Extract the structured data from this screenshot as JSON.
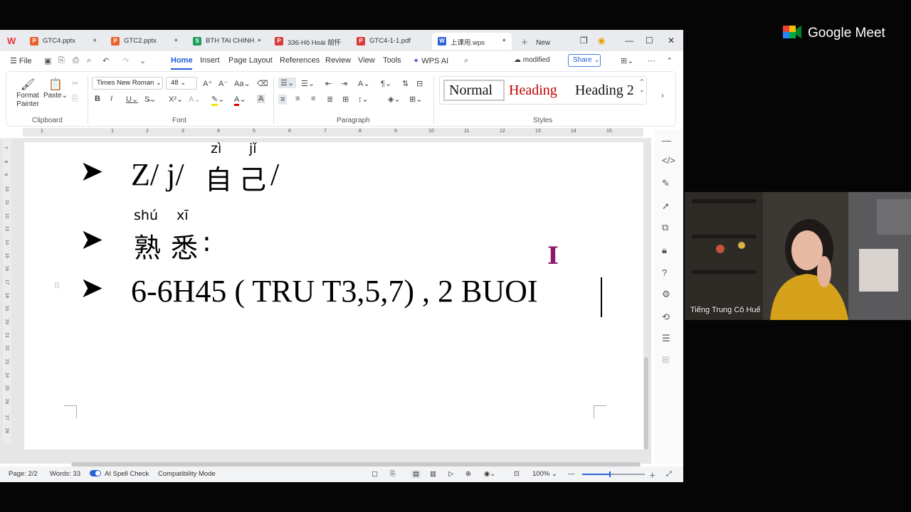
{
  "tabs": [
    {
      "label": "GTC4.pptx",
      "type": "P",
      "color": "#e8622b"
    },
    {
      "label": "GTC2.pptx",
      "type": "P",
      "color": "#e8622b"
    },
    {
      "label": "BTH TAI CHINH",
      "type": "S",
      "color": "#1e9e5a"
    },
    {
      "label": "336-Hồ Hoài 胡怀",
      "type": "P",
      "color": "#d83a3a"
    },
    {
      "label": "GTC4-1-1.pdf",
      "type": "P",
      "color": "#d83a3a"
    },
    {
      "label": "上课用.wps",
      "type": "W",
      "color": "#2a62d6"
    }
  ],
  "new_tab": "New",
  "menu": {
    "file": "File",
    "items": [
      "Home",
      "Insert",
      "Page Layout",
      "References",
      "Review",
      "View",
      "Tools"
    ],
    "wps_ai": "WPS AI",
    "modified": "modified",
    "share": "Share"
  },
  "ribbon": {
    "format_painter": "Format Painter",
    "paste": "Paste",
    "clipboard": "Clipboard",
    "font_name": "Times New Roman",
    "font_size": "48",
    "font_group": "Font",
    "paragraph_group": "Paragraph",
    "styles_group": "Styles",
    "style_normal": "Normal",
    "style_heading1": "Heading",
    "style_heading2": "Heading 2"
  },
  "ruler": [
    "1",
    "1",
    "2",
    "3",
    "4",
    "5",
    "6",
    "7",
    "8",
    "9",
    "10",
    "11",
    "12",
    "13",
    "14",
    "15"
  ],
  "vruler": [
    "7",
    "8",
    "9",
    "10",
    "11",
    "12",
    "13",
    "14",
    "15",
    "16",
    "17",
    "18",
    "19",
    "20",
    "21",
    "22",
    "23",
    "24",
    "25",
    "26",
    "27",
    "28"
  ],
  "document": {
    "line1_latin": "Z/ j/",
    "line1_pinyin": [
      "zì",
      "jǐ"
    ],
    "line1_chars": [
      "自",
      "己"
    ],
    "line1_tail": "/",
    "line2_pinyin": [
      "shú",
      "xī"
    ],
    "line2_chars": [
      "熟",
      "悉"
    ],
    "line2_tail": ":",
    "line3": "6-6H45 ( TRU T3,5,7) , 2 BUOI"
  },
  "status": {
    "page": "Page: 2/2",
    "words": "Words: 33",
    "spell": "AI Spell Check",
    "mode": "Compatibility Mode",
    "zoom": "100%"
  },
  "meet": {
    "brand": "Google Meet",
    "participant": "Tiếng Trung Cô Huế"
  }
}
